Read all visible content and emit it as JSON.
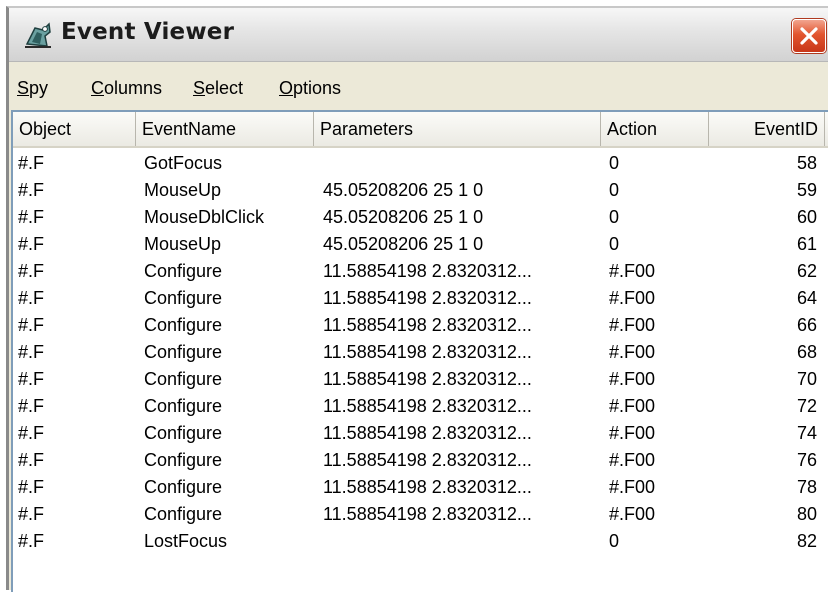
{
  "window": {
    "title": "Event Viewer",
    "icon": "spy-app-icon",
    "close_label": "close"
  },
  "menu": [
    {
      "label": "Spy",
      "mnemonic": "S",
      "rest": "py"
    },
    {
      "label": "Columns",
      "mnemonic": "C",
      "rest": "olumns"
    },
    {
      "label": "Select",
      "mnemonic": "S",
      "rest": "elect"
    },
    {
      "label": "Options",
      "mnemonic": "O",
      "rest": "ptions"
    }
  ],
  "columns": [
    "Object",
    "EventName",
    "Parameters",
    "Action",
    "EventID"
  ],
  "rows": [
    [
      "#.F",
      "GotFocus",
      "",
      "0",
      "58"
    ],
    [
      "#.F",
      "MouseUp",
      "45.05208206 25 1 0",
      "0",
      "59"
    ],
    [
      "#.F",
      "MouseDblClick",
      "45.05208206 25 1 0",
      "0",
      "60"
    ],
    [
      "#.F",
      "MouseUp",
      "45.05208206 25 1 0",
      "0",
      "61"
    ],
    [
      "#.F",
      "Configure",
      "11.58854198 2.8320312...",
      "#.F00",
      "62"
    ],
    [
      "#.F",
      "Configure",
      "11.58854198 2.8320312...",
      "#.F00",
      "64"
    ],
    [
      "#.F",
      "Configure",
      "11.58854198 2.8320312...",
      "#.F00",
      "66"
    ],
    [
      "#.F",
      "Configure",
      "11.58854198 2.8320312...",
      "#.F00",
      "68"
    ],
    [
      "#.F",
      "Configure",
      "11.58854198 2.8320312...",
      "#.F00",
      "70"
    ],
    [
      "#.F",
      "Configure",
      "11.58854198 2.8320312...",
      "#.F00",
      "72"
    ],
    [
      "#.F",
      "Configure",
      "11.58854198 2.8320312...",
      "#.F00",
      "74"
    ],
    [
      "#.F",
      "Configure",
      "11.58854198 2.8320312...",
      "#.F00",
      "76"
    ],
    [
      "#.F",
      "Configure",
      "11.58854198 2.8320312...",
      "#.F00",
      "78"
    ],
    [
      "#.F",
      "Configure",
      "11.58854198 2.8320312...",
      "#.F00",
      "80"
    ],
    [
      "#.F",
      "LostFocus",
      "",
      "0",
      "82"
    ]
  ],
  "colors": {
    "close_button": "#e2552f",
    "list_border": "#7f9db9",
    "window_face": "#ece9d8"
  }
}
